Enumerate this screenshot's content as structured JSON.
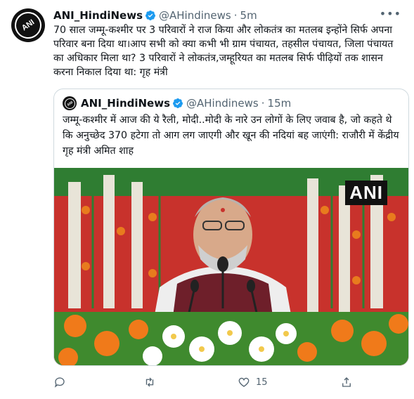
{
  "tweet": {
    "author_name": "ANI_HindiNews",
    "handle": "@AHindinews",
    "time": "5m",
    "avatar_text": "ANI",
    "text": "70 साल जम्मू-कश्मीर पर 3 परिवारों ने राज किया और लोकतंत्र का मतलब इन्होंने सिर्फ अपना परिवार बना दिया था।आप सभी को क्या कभी भी ग्राम पंचायत, तहसील पंचायत, जिला पंचायत का अधिकार मिला था? 3 परिवारों ने लोकतंत्र,जम्हूरियत का मतलब सिर्फ पीढ़ियों तक शासन करना निकाल दिया था: गृह मंत्री",
    "more_icon": "more-icon"
  },
  "quoted": {
    "author_name": "ANI_HindiNews",
    "handle": "@AHindinews",
    "time": "15m",
    "avatar_text": "ANI",
    "text": "जम्मू-कश्मीर में आज की ये रैली, मोदी..मोदी के नारे उन लोगों के लिए जवाब है, जो कहते थे कि अनुच्छेद 370 हटेगा तो आग लग जाएगी और खून की नदियां बह जाएंगी: राजौरी में केंद्रीय गृह मंत्री अमित शाह",
    "media_watermark": "ANI"
  },
  "actions": {
    "reply_count": "",
    "retweet_count": "",
    "like_count": "15",
    "share_count": ""
  },
  "colors": {
    "verified": "#1d9bf0",
    "muted": "#536471",
    "border": "#cfd9de"
  }
}
